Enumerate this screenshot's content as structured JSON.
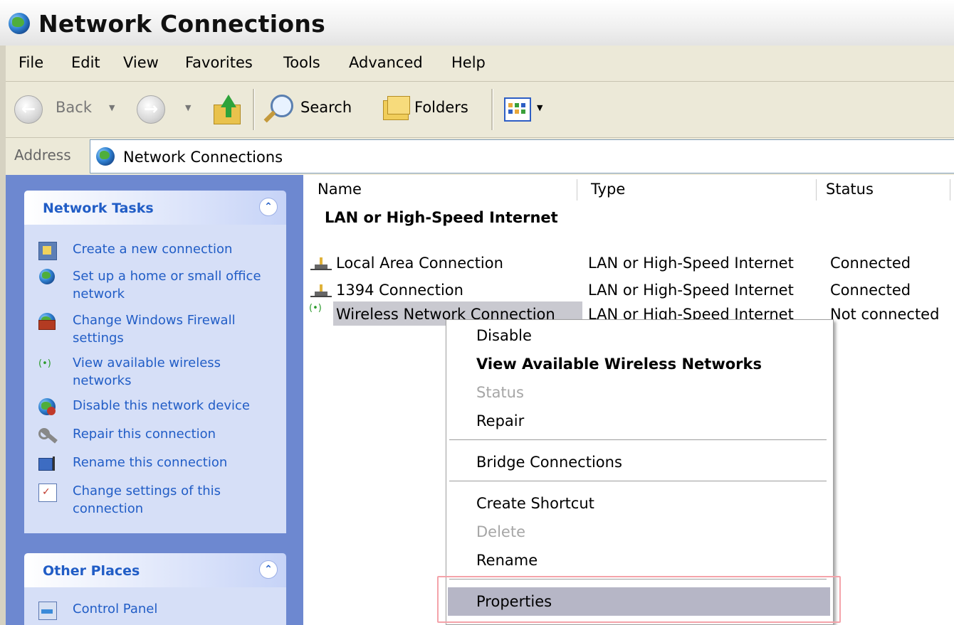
{
  "window": {
    "title": "Network Connections"
  },
  "menubar": {
    "items": [
      "File",
      "Edit",
      "View",
      "Favorites",
      "Tools",
      "Advanced",
      "Help"
    ]
  },
  "toolbar": {
    "back_label": "Back",
    "search_label": "Search",
    "folders_label": "Folders"
  },
  "address": {
    "label": "Address",
    "value": "Network Connections"
  },
  "taskpane": {
    "network_tasks": {
      "title": "Network Tasks",
      "items": [
        {
          "label": "Create a new connection",
          "icon": "new-connection-icon"
        },
        {
          "label": "Set up a home or small office network",
          "icon": "home-network-icon"
        },
        {
          "label": "Change Windows Firewall settings",
          "icon": "firewall-icon"
        },
        {
          "label": "View available wireless networks",
          "icon": "wireless-icon"
        },
        {
          "label": "Disable this network device",
          "icon": "disable-device-icon"
        },
        {
          "label": "Repair this connection",
          "icon": "repair-icon"
        },
        {
          "label": "Rename this connection",
          "icon": "rename-icon"
        },
        {
          "label": "Change settings of this connection",
          "icon": "settings-icon"
        }
      ]
    },
    "other_places": {
      "title": "Other Places",
      "items": [
        {
          "label": "Control Panel",
          "icon": "control-panel-icon"
        }
      ]
    }
  },
  "list": {
    "columns": [
      "Name",
      "Type",
      "Status"
    ],
    "group_title": "LAN or High-Speed Internet",
    "rows": [
      {
        "name": "Local Area Connection",
        "type": "LAN or High-Speed Internet",
        "status": "Connected"
      },
      {
        "name": "1394 Connection",
        "type": "LAN or High-Speed Internet",
        "status": "Connected"
      },
      {
        "name": "Wireless Network Connection",
        "type": "LAN or High-Speed Internet",
        "status": "Not connected"
      }
    ]
  },
  "context_menu": {
    "items": [
      {
        "label": "Disable",
        "state": "normal"
      },
      {
        "label": "View Available Wireless Networks",
        "state": "default"
      },
      {
        "label": "Status",
        "state": "disabled"
      },
      {
        "label": "Repair",
        "state": "normal"
      },
      {
        "label": "Bridge Connections",
        "state": "normal"
      },
      {
        "label": "Create Shortcut",
        "state": "normal"
      },
      {
        "label": "Delete",
        "state": "disabled"
      },
      {
        "label": "Rename",
        "state": "normal"
      },
      {
        "label": "Properties",
        "state": "hover"
      }
    ]
  },
  "colors": {
    "taskpane_bg": "#6d88d0",
    "task_link": "#215dc6",
    "highlight_box": "#f4a3aa",
    "menu_hover": "#b6b6c6"
  }
}
